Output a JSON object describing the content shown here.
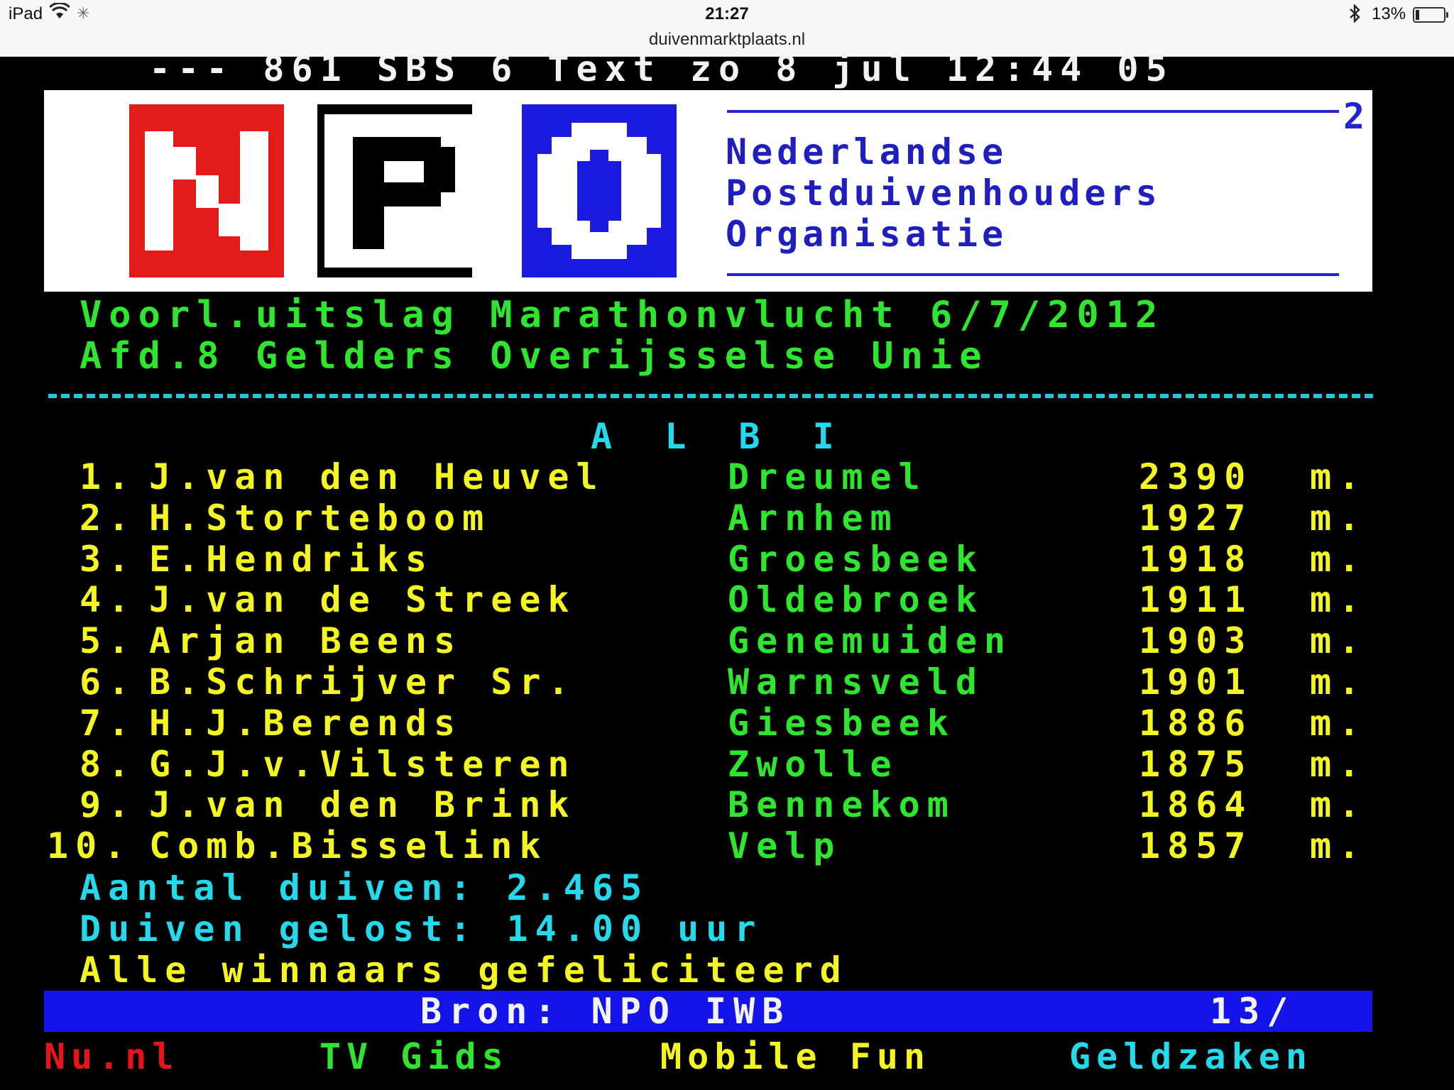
{
  "status_bar": {
    "device": "iPad",
    "time": "21:27",
    "url": "duivenmarktplaats.nl",
    "battery_percent": "13%",
    "battery_level": 0.13,
    "icons": [
      "wifi-icon",
      "loading-spinner-icon",
      "bluetooth-icon",
      "battery-icon"
    ]
  },
  "teletext": {
    "header": "--- 861 SBS 6 Text zo 8 jul 12:44 05",
    "logo": {
      "letters": [
        "N",
        "P",
        "O"
      ],
      "page_number": "2",
      "organization": [
        "Nederlandse",
        "Postduivenhouders",
        "Organisatie"
      ]
    },
    "title_line1": "Voorl.uitslag Marathonvlucht 6/7/2012",
    "title_line2": "Afd.8 Gelders Overijsselse Unie",
    "station": "A L B I",
    "results": [
      {
        "rank": "1.",
        "name": "J.van den Heuvel",
        "place": "Dreumel",
        "distance": "2390",
        "unit": "m."
      },
      {
        "rank": "2.",
        "name": "H.Storteboom",
        "place": "Arnhem",
        "distance": "1927",
        "unit": "m."
      },
      {
        "rank": "3.",
        "name": "E.Hendriks",
        "place": "Groesbeek",
        "distance": "1918",
        "unit": "m."
      },
      {
        "rank": "4.",
        "name": "J.van de Streek",
        "place": "Oldebroek",
        "distance": "1911",
        "unit": "m."
      },
      {
        "rank": "5.",
        "name": "Arjan Beens",
        "place": "Genemuiden",
        "distance": "1903",
        "unit": "m."
      },
      {
        "rank": "6.",
        "name": "B.Schrijver Sr.",
        "place": "Warnsveld",
        "distance": "1901",
        "unit": "m."
      },
      {
        "rank": "7.",
        "name": "H.J.Berends",
        "place": "Giesbeek",
        "distance": "1886",
        "unit": "m."
      },
      {
        "rank": "8.",
        "name": "G.J.v.Vilsteren",
        "place": "Zwolle",
        "distance": "1875",
        "unit": "m."
      },
      {
        "rank": "9.",
        "name": "J.van den Brink",
        "place": "Bennekom",
        "distance": "1864",
        "unit": "m."
      },
      {
        "rank": "10.",
        "name": "Comb.Bisselink",
        "place": "Velp",
        "distance": "1857",
        "unit": "m."
      }
    ],
    "info_lines": [
      "Aantal duiven: 2.465",
      "Duiven gelost: 14.00 uur",
      "Alle winnaars gefeliciteerd"
    ],
    "footer_bar": {
      "source": "Bron: NPO IWB",
      "page": "13/"
    },
    "fastext": [
      {
        "label": "Nu.nl",
        "color": "#e8141a"
      },
      {
        "label": "TV Gids",
        "color": "#2ee62e"
      },
      {
        "label": "Mobile Fun",
        "color": "#f4f420"
      },
      {
        "label": "Geldzaken",
        "color": "#23d9ec"
      }
    ]
  }
}
